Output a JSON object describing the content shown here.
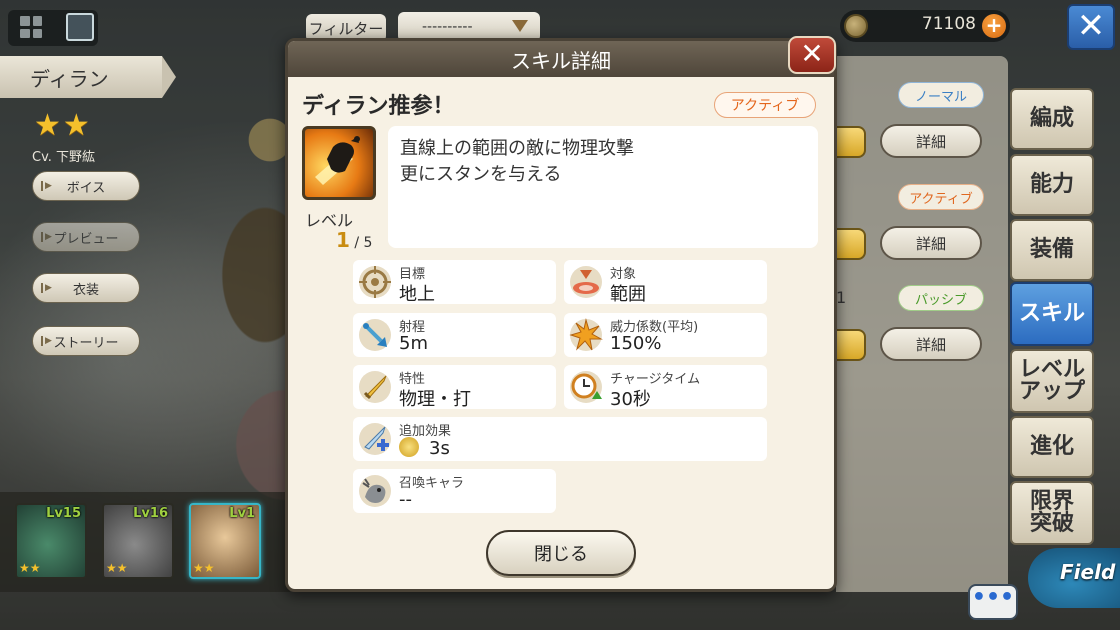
{
  "top": {
    "filter_label": "フィルター",
    "filter_value": "----------",
    "coins": "71108"
  },
  "character": {
    "name": "ディラン",
    "stars": "★★",
    "cv": "Cv. 下野紘",
    "buttons": [
      "ボイス",
      "プレビュー",
      "衣装",
      "ストーリー"
    ]
  },
  "party": [
    {
      "level": "Lv15",
      "stars": "★★"
    },
    {
      "level": "Lv16",
      "stars": "★★"
    },
    {
      "level": "Lv1",
      "stars": "★★"
    }
  ],
  "skill_list": {
    "tags": [
      "ノーマル",
      "アクティブ",
      "パッシブ"
    ],
    "detail_label": "詳細",
    "stub_text": "1"
  },
  "tabs": [
    "編成",
    "能力",
    "装備",
    "スキル",
    "レベルアップ",
    "進化",
    "限界突破"
  ],
  "tabs_display": [
    "編成",
    "能力",
    "装備",
    "スキル",
    "レベル\nアップ",
    "進化",
    "限界\n突破"
  ],
  "selected_tab": "スキル",
  "field_label": "Field",
  "chat_label": "•••",
  "dialog": {
    "title": "スキル詳細",
    "close_x": "✕",
    "skill_name": "ディラン推参！",
    "skill_type": "アクティブ",
    "level_label": "レベル",
    "level_current": "1",
    "level_max": "/ 5",
    "description": [
      "直線上の範囲の敵に物理攻撃",
      "更にスタンを与える"
    ],
    "stats": [
      {
        "label": "目標",
        "value": "地上",
        "icon": "target-icon"
      },
      {
        "label": "対象",
        "value": "範囲",
        "icon": "area-icon"
      },
      {
        "label": "射程",
        "value": "5m",
        "icon": "range-arrow-icon"
      },
      {
        "label": "威力係数(平均)",
        "value": "150%",
        "icon": "power-burst-icon"
      },
      {
        "label": "特性",
        "value": "物理・打",
        "icon": "sword-icon"
      },
      {
        "label": "チャージタイム",
        "value": "30秒",
        "icon": "clock-icon"
      },
      {
        "label": "追加効果",
        "value": "3s",
        "icon": "sword-plus-icon"
      },
      {
        "label": "召喚キャラ",
        "value": "--",
        "icon": "summon-icon"
      }
    ],
    "close_button": "閉じる"
  },
  "colors": {
    "accent_blue": "#2c6cc0",
    "active_orange": "#e4661c",
    "normal_blue": "#3a7fc4",
    "passive_green": "#4a9a2a",
    "star_gold": "#f4c02c"
  }
}
